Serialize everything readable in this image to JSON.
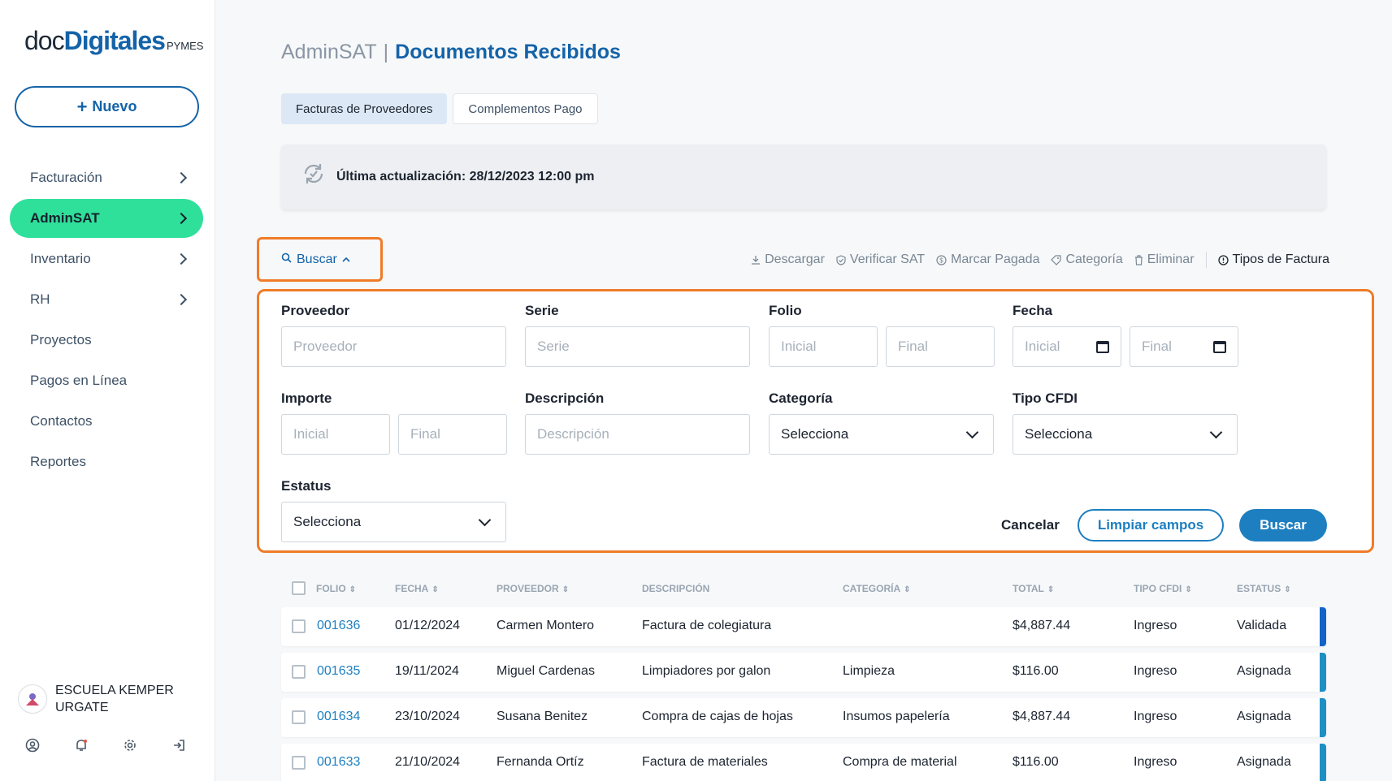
{
  "logo": {
    "part1": "doc",
    "part2": "Digitales",
    "part3": "PYMES"
  },
  "new_button": {
    "plus": "+",
    "label": "Nuevo"
  },
  "nav": [
    {
      "label": "Facturación",
      "chevron": true
    },
    {
      "label": "AdminSAT",
      "chevron": true,
      "active": true
    },
    {
      "label": "Inventario",
      "chevron": true
    },
    {
      "label": "RH",
      "chevron": true
    },
    {
      "label": "Proyectos"
    },
    {
      "label": "Pagos en Línea"
    },
    {
      "label": "Contactos"
    },
    {
      "label": "Reportes"
    }
  ],
  "company": {
    "name_line1": "ESCUELA KEMPER",
    "name_line2": "URGATE"
  },
  "footer_icons": [
    "user-circle-icon",
    "bell-icon",
    "gear-icon",
    "logout-icon"
  ],
  "breadcrumb": {
    "section": "AdminSAT",
    "separator": "|",
    "page": "Documentos Recibidos"
  },
  "tabs": [
    {
      "label": "Facturas de Proveedores",
      "active": true
    },
    {
      "label": "Complementos Pago",
      "active": false
    }
  ],
  "update": {
    "text": "Última actualización: 28/12/2023 12:00 pm"
  },
  "search_toggle": {
    "label": "Buscar"
  },
  "actions": {
    "descargar": "Descargar",
    "verificar": "Verificar SAT",
    "marcar": "Marcar Pagada",
    "categoria": "Categoría",
    "eliminar": "Eliminar",
    "tipos": "Tipos de Factura"
  },
  "filters": {
    "proveedor": {
      "label": "Proveedor",
      "placeholder": "Proveedor"
    },
    "serie": {
      "label": "Serie",
      "placeholder": "Serie"
    },
    "folio": {
      "label": "Folio",
      "inicial": "Inicial",
      "final": "Final"
    },
    "fecha": {
      "label": "Fecha",
      "inicial": "Inicial",
      "final": "Final"
    },
    "importe": {
      "label": "Importe",
      "inicial": "Inicial",
      "final": "Final"
    },
    "descripcion": {
      "label": "Descripción",
      "placeholder": "Descripción"
    },
    "categoria": {
      "label": "Categoría",
      "value": "Selecciona"
    },
    "tipo_cfdi": {
      "label": "Tipo CFDI",
      "value": "Selecciona"
    },
    "estatus": {
      "label": "Estatus",
      "value": "Selecciona"
    },
    "cancel": "Cancelar",
    "clear": "Limpiar campos",
    "search": "Buscar"
  },
  "table": {
    "headers": {
      "folio": "FOLIO",
      "fecha": "FECHA",
      "proveedor": "PROVEEDOR",
      "descripcion": "DESCRIPCIÓN",
      "categoria": "CATEGORÍA",
      "total": "TOTAL",
      "tipo": "TIPO CFDI",
      "estatus": "ESTATUS"
    },
    "rows": [
      {
        "folio": "001636",
        "fecha": "01/12/2024",
        "proveedor": "Carmen Montero",
        "descripcion": "Factura de colegiatura",
        "categoria": "",
        "total": "$4,887.44",
        "tipo": "Ingreso",
        "estatus": "Validada",
        "edge_color": "#1463c8"
      },
      {
        "folio": "001635",
        "fecha": "19/11/2024",
        "proveedor": "Miguel Cardenas",
        "descripcion": "Limpiadores por galon",
        "categoria": "Limpieza",
        "total": "$116.00",
        "tipo": "Ingreso",
        "estatus": "Asignada",
        "edge_color": "#1e8fc4"
      },
      {
        "folio": "001634",
        "fecha": "23/10/2024",
        "proveedor": "Susana Benitez",
        "descripcion": "Compra de cajas de hojas",
        "categoria": "Insumos papelería",
        "total": "$4,887.44",
        "tipo": "Ingreso",
        "estatus": "Asignada",
        "edge_color": "#1e8fc4"
      },
      {
        "folio": "001633",
        "fecha": "21/10/2024",
        "proveedor": "Fernanda Ortíz",
        "descripcion": "Factura de materiales",
        "categoria": "Compra de material",
        "total": "$116.00",
        "tipo": "Ingreso",
        "estatus": "Asignada",
        "edge_color": "#1e8fc4"
      }
    ]
  }
}
